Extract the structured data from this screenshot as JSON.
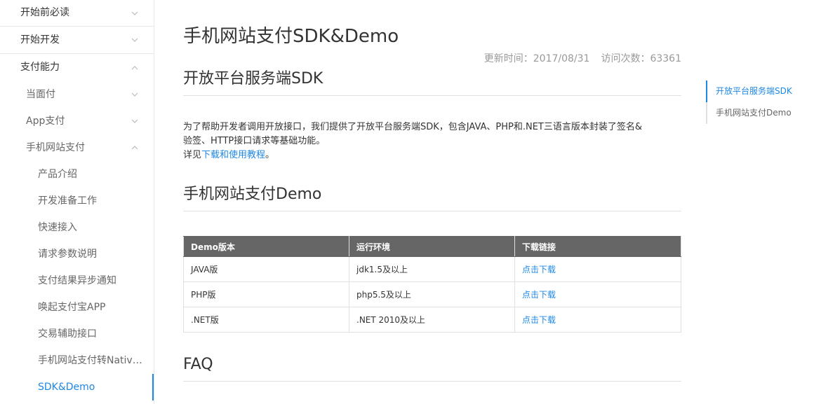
{
  "sidebar": {
    "items": [
      {
        "label": "开始前必读",
        "level": 1,
        "expanded": false
      },
      {
        "label": "开始开发",
        "level": 1,
        "expanded": false
      },
      {
        "label": "支付能力",
        "level": 1,
        "expanded": true
      },
      {
        "label": "当面付",
        "level": 2,
        "expanded": false
      },
      {
        "label": "App支付",
        "level": 2,
        "expanded": false
      },
      {
        "label": "手机网站支付",
        "level": 2,
        "expanded": true
      },
      {
        "label": "产品介绍",
        "level": 3
      },
      {
        "label": "开发准备工作",
        "level": 3
      },
      {
        "label": "快速接入",
        "level": 3
      },
      {
        "label": "请求参数说明",
        "level": 3
      },
      {
        "label": "支付结果异步通知",
        "level": 3
      },
      {
        "label": "唤起支付宝APP",
        "level": 3
      },
      {
        "label": "交易辅助接口",
        "level": 3
      },
      {
        "label": "手机网站支付转Native支付",
        "level": 3
      },
      {
        "label": "SDK&Demo",
        "level": 3,
        "active": true
      }
    ]
  },
  "main": {
    "title": "手机网站支付SDK&Demo",
    "meta": {
      "updated_label": "更新时间：",
      "updated_value": "2017/08/31",
      "visits_label": "访问次数：",
      "visits_value": "63361"
    },
    "sections": {
      "sdk": {
        "heading": "开放平台服务端SDK",
        "line1": "为了帮助开发者调用开放接口，我们提供了开放平台服务端SDK，包含JAVA、PHP和.NET三语言版本封装了签名&",
        "line2": "验签、HTTP接口请求等基础功能。",
        "line3_prefix": "详见",
        "line3_link": "下载和使用教程",
        "line3_suffix": "。"
      },
      "demo": {
        "heading": "手机网站支付Demo",
        "table": {
          "headers": [
            "Demo版本",
            "运行环境",
            "下载链接"
          ],
          "rows": [
            {
              "version": "JAVA版",
              "env": "jdk1.5及以上",
              "link": "点击下载"
            },
            {
              "version": "PHP版",
              "env": "php5.5及以上",
              "link": "点击下载"
            },
            {
              "version": ".NET版",
              "env": ".NET 2010及以上",
              "link": "点击下载"
            }
          ]
        }
      },
      "faq": {
        "heading": "FAQ"
      }
    }
  },
  "toc": {
    "items": [
      {
        "label": "开放平台服务端SDK",
        "active": true
      },
      {
        "label": "手机网站支付Demo",
        "active": false
      }
    ]
  },
  "colors": {
    "accent": "#1e88e5",
    "table_header_bg": "#666666",
    "muted_text": "#999999"
  }
}
